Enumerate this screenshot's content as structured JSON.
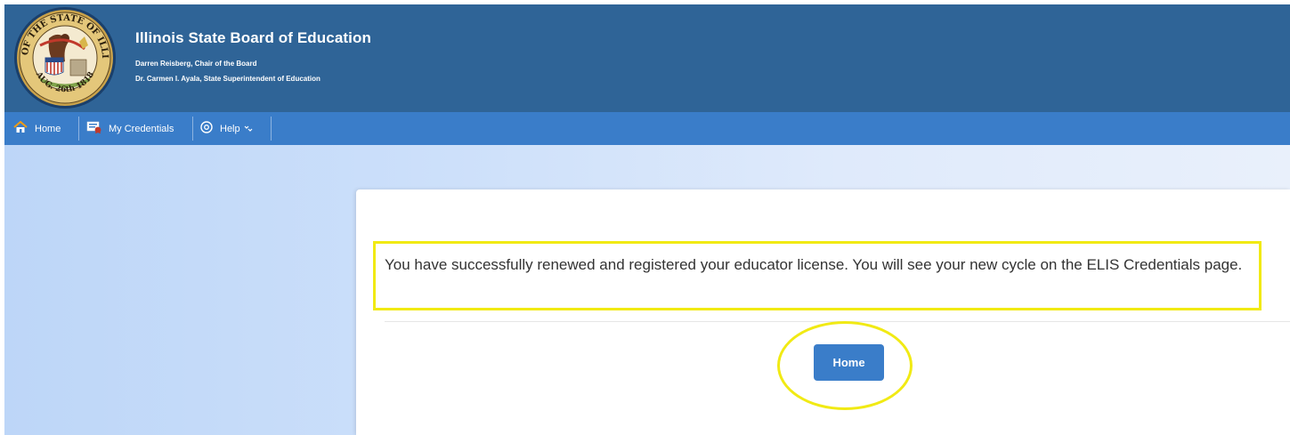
{
  "header": {
    "title": "Illinois State Board of Education",
    "line1": "Darren Reisberg, Chair of the Board",
    "line2": "Dr. Carmen I. Ayala, State Superintendent of Education",
    "seal_text": "SEAL OF THE STATE OF ILLINOIS",
    "seal_date": "AUG. 26th 1818",
    "seal_icon": "state-seal-icon",
    "bg_color": "#2f6497"
  },
  "nav": {
    "items": [
      {
        "label": "Home",
        "icon": "house-icon"
      },
      {
        "label": "My Credentials",
        "icon": "credentials-icon"
      },
      {
        "label": "Help",
        "icon": "help-circle-icon",
        "dropdown_icon": "chevron-down-icon"
      }
    ],
    "bg_color": "#3a7dc9"
  },
  "main": {
    "message": "You have successfully renewed and registered your educator license. You will see your new cycle on the ELIS Credentials page.",
    "home_button_label": "Home",
    "highlight_color": "#f1ea14"
  }
}
